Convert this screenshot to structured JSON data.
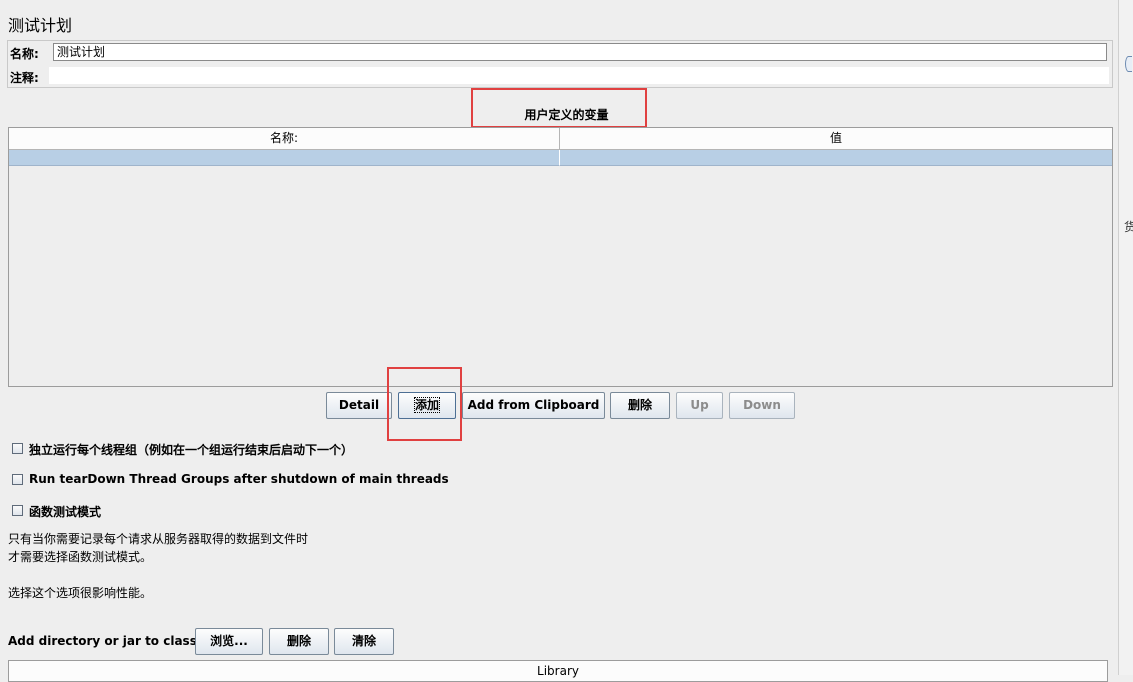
{
  "page_title": "测试计划",
  "name_field": {
    "label": "名称:",
    "value": "测试计划"
  },
  "comment_field": {
    "label": "注释:",
    "value": ""
  },
  "variables_section": {
    "title": "用户定义的变量",
    "columns": [
      "名称:",
      "值"
    ]
  },
  "table_buttons": {
    "detail": "Detail",
    "add": "添加",
    "add_clipboard": "Add from Clipboard",
    "delete": "删除",
    "up": "Up",
    "down": "Down"
  },
  "options": {
    "serialize_thread_groups": "独立运行每个线程组（例如在一个组运行结束后启动下一个）",
    "teardown_after_shutdown": "Run tearDown Thread Groups after shutdown of main threads",
    "functional_mode": "函数测试模式"
  },
  "functional_note": {
    "line1": "只有当你需要记录每个请求从服务器取得的数据到文件时",
    "line2": "才需要选择函数测试模式。",
    "line3": "选择这个选项很影响性能。"
  },
  "classpath": {
    "label": "Add directory or jar to classpath",
    "browse": "浏览...",
    "delete": "删除",
    "clear": "清除",
    "library_header": "Library"
  },
  "right_edge_char": "货"
}
